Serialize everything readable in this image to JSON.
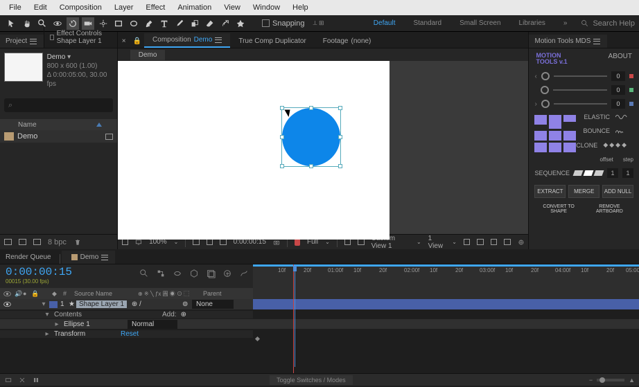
{
  "menu": {
    "items": [
      "File",
      "Edit",
      "Composition",
      "Layer",
      "Effect",
      "Animation",
      "View",
      "Window",
      "Help"
    ]
  },
  "toolbar": {
    "snapping_label": "Snapping",
    "workspaces": [
      "Default",
      "Standard",
      "Small Screen",
      "Libraries"
    ],
    "active_workspace": "Default",
    "search_placeholder": "Search Help"
  },
  "project": {
    "tabs": {
      "project": "Project",
      "fx": "Effect Controls Shape Layer 1"
    },
    "name": "Demo",
    "dims": "800 x 600 (1.00)",
    "duration": "Δ 0:00:05:00, 30.00 fps",
    "search_placeholder": "⌕",
    "col_name": "Name",
    "items": [
      {
        "name": "Demo"
      }
    ],
    "footer_bpc": "8 bpc"
  },
  "viewer": {
    "tabs": {
      "comp_prefix": "Composition",
      "comp_name": "Demo",
      "dup": "True Comp Duplicator",
      "footage_prefix": "Footage",
      "footage_name": "(none)"
    },
    "subtab": "Demo",
    "footer": {
      "zoom": "100%",
      "time": "0:00:00:15",
      "res": "Full",
      "view_mode": "Custom View 1",
      "views": "1 View"
    }
  },
  "mtools": {
    "tab": "Motion Tools MDS",
    "brand1": "MOTION",
    "brand2": "TOOLS v.1",
    "about": "ABOUT",
    "sliders": [
      {
        "axis": "‹",
        "value": "0",
        "dot": "r"
      },
      {
        "axis": "",
        "value": "0",
        "dot": "g"
      },
      {
        "axis": "›",
        "value": "0",
        "dot": "b"
      }
    ],
    "elastic": "ELASTIC",
    "bounce": "BOUNCE",
    "clone": "CLONE",
    "offset": "offset",
    "step": "step",
    "sequence": "SEQUENCE",
    "seq_in1": "1",
    "seq_in2": "1",
    "btns": [
      "EXTRACT",
      "MERGE",
      "ADD NULL"
    ],
    "btns2": [
      "CONVERT TO SHAPE",
      "REMOVE ARTBOARD"
    ]
  },
  "timeline": {
    "tabs": {
      "rq": "Render Queue",
      "comp": "Demo"
    },
    "timecode": "0:00:00:15",
    "timecode_sub": "00015 (30.00 fps)",
    "col_left": {
      "num": "#",
      "src": "Source Name",
      "parent": "Parent"
    },
    "playhead_f": "15f",
    "ruler": [
      "10f",
      "20f",
      "01:00f",
      "10f",
      "20f",
      "02:00f",
      "10f",
      "20f",
      "03:00f",
      "10f",
      "20f",
      "04:00f",
      "10f",
      "20f",
      "05:00"
    ],
    "layer": {
      "num": "1",
      "name": "Shape Layer 1",
      "mode": "None"
    },
    "props": {
      "contents": "Contents",
      "add": "Add:",
      "ellipse": "Ellipse 1",
      "ellipse_mode": "Normal",
      "transform": "Transform",
      "reset": "Reset"
    },
    "toggle": "Toggle Switches / Modes"
  }
}
